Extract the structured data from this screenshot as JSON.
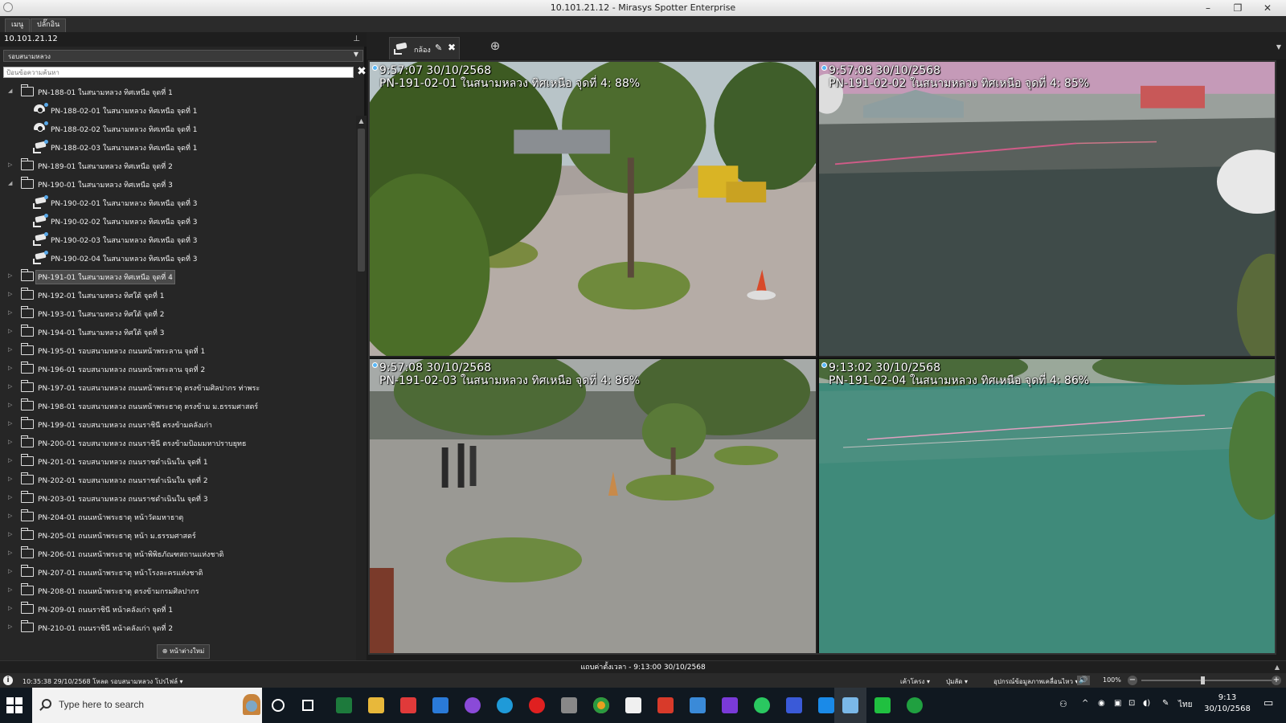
{
  "window": {
    "title": "10.101.21.12 - Mirasys Spotter Enterprise",
    "minimize": "–",
    "maximize": "❐",
    "close": "✕"
  },
  "menu_tabs": [
    "เมนู",
    "ปลั๊กอิน"
  ],
  "server": {
    "address": "10.101.21.12",
    "pin": "⊥"
  },
  "group_select": {
    "value": "รอบสนามหลวง",
    "caret": "▼"
  },
  "search": {
    "placeholder": "ป้อนข้อความค้นหา",
    "clear": "✖"
  },
  "tree": [
    {
      "type": "folder",
      "expander": "◢",
      "label": "PN-188-01 ในสนามหลวง ทิศเหนือ จุดที่ 1"
    },
    {
      "type": "dome",
      "label": "PN-188-02-01 ในสนามหลวง ทิศเหนือ จุดที่ 1"
    },
    {
      "type": "dome",
      "label": "PN-188-02-02 ในสนามหลวง ทิศเหนือ จุดที่ 1"
    },
    {
      "type": "bullet",
      "label": "PN-188-02-03 ในสนามหลวง ทิศเหนือ จุดที่ 1"
    },
    {
      "type": "folder",
      "expander": "▷",
      "label": "PN-189-01 ในสนามหลวง ทิศเหนือ จุดที่ 2"
    },
    {
      "type": "folder",
      "expander": "◢",
      "label": "PN-190-01 ในสนามหลวง ทิศเหนือ จุดที่ 3"
    },
    {
      "type": "bullet",
      "label": "PN-190-02-01 ในสนามหลวง ทิศเหนือ จุดที่ 3"
    },
    {
      "type": "bullet",
      "label": "PN-190-02-02 ในสนามหลวง ทิศเหนือ จุดที่ 3"
    },
    {
      "type": "bullet",
      "label": "PN-190-02-03 ในสนามหลวง ทิศเหนือ จุดที่ 3"
    },
    {
      "type": "bullet",
      "label": "PN-190-02-04 ในสนามหลวง ทิศเหนือ จุดที่ 3"
    },
    {
      "type": "folder",
      "expander": "▷",
      "label": "PN-191-01 ในสนามหลวง ทิศเหนือ จุดที่ 4",
      "selected": true
    },
    {
      "type": "folder",
      "expander": "▷",
      "label": "PN-192-01 ในสนามหลวง ทิศใต้ จุดที่ 1"
    },
    {
      "type": "folder",
      "expander": "▷",
      "label": "PN-193-01 ในสนามหลวง ทิศใต้ จุดที่ 2"
    },
    {
      "type": "folder",
      "expander": "▷",
      "label": "PN-194-01 ในสนามหลวง ทิศใต้ จุดที่ 3"
    },
    {
      "type": "folder",
      "expander": "▷",
      "label": "PN-195-01 รอบสนามหลวง ถนนหน้าพระลาน จุดที่ 1"
    },
    {
      "type": "folder",
      "expander": "▷",
      "label": "PN-196-01 รอบสนามหลวง ถนนหน้าพระลาน จุดที่ 2"
    },
    {
      "type": "folder",
      "expander": "▷",
      "label": "PN-197-01 รอบสนามหลวง ถนนหน้าพระธาตุ ตรงข้ามศิลปากร ท่าพระ"
    },
    {
      "type": "folder",
      "expander": "▷",
      "label": "PN-198-01 รอบสนามหลวง ถนนหน้าพระธาตุ ตรงข้าม ม.ธรรมศาสตร์"
    },
    {
      "type": "folder",
      "expander": "▷",
      "label": "PN-199-01 รอบสนามหลวง ถนนราชินี ตรงข้ามคลังเก่า"
    },
    {
      "type": "folder",
      "expander": "▷",
      "label": "PN-200-01 รอบสนามหลวง ถนนราชินี ตรงข้ามป้อมมหาปราบยุทธ"
    },
    {
      "type": "folder",
      "expander": "▷",
      "label": "PN-201-01 รอบสนามหลวง ถนนราชดำเนินใน จุดที่ 1"
    },
    {
      "type": "folder",
      "expander": "▷",
      "label": "PN-202-01 รอบสนามหลวง ถนนราชดำเนินใน จุดที่ 2"
    },
    {
      "type": "folder",
      "expander": "▷",
      "label": "PN-203-01 รอบสนามหลวง ถนนราชดำเนินใน จุดที่ 3"
    },
    {
      "type": "folder",
      "expander": "▷",
      "label": "PN-204-01 ถนนหน้าพระธาตุ หน้าวัดมหาธาตุ"
    },
    {
      "type": "folder",
      "expander": "▷",
      "label": "PN-205-01 ถนนหน้าพระธาตุ หน้า ม.ธรรมศาสตร์"
    },
    {
      "type": "folder",
      "expander": "▷",
      "label": "PN-206-01 ถนนหน้าพระธาตุ หน้าพิพิธภัณฑสถานแห่งชาติ"
    },
    {
      "type": "folder",
      "expander": "▷",
      "label": "PN-207-01 ถนนหน้าพระธาตุ หน้าโรงละครแห่งชาติ"
    },
    {
      "type": "folder",
      "expander": "▷",
      "label": "PN-208-01 ถนนหน้าพระธาตุ ตรงข้ามกรมศิลปากร"
    },
    {
      "type": "folder",
      "expander": "▷",
      "label": "PN-209-01 ถนนราชินี หน้าคลังเก่า จุดที่ 1"
    },
    {
      "type": "folder",
      "expander": "▷",
      "label": "PN-210-01 ถนนราชินี หน้าคลังเก่า จุดที่ 2"
    }
  ],
  "new_page_button": "⊕ หน้าต่างใหม่",
  "view": {
    "tab_label": "กล้อง",
    "tab_edit": "✎",
    "tab_close": "✖",
    "add_tab": "⊕",
    "menu_caret": "▼"
  },
  "tiles": [
    {
      "time": "9:57:07  30/10/2568",
      "name": "PN-191-02-01 ในสนามหลวง ทิศเหนือ จุดที่ 4: 88%"
    },
    {
      "time": "9:57:08  30/10/2568",
      "name": "PN-191-02-02 ในสนามหลวง ทิศเหนือ จุดที่ 4: 85%"
    },
    {
      "time": "9:57:08  30/10/2568",
      "name": "PN-191-02-03 ในสนามหลวง ทิศเหนือ จุดที่ 4: 86%"
    },
    {
      "time": "9:13:02  30/10/2568",
      "name": "PN-191-02-04 ในสนามหลวง ทิศเหนือ จุดที่ 4: 86%"
    }
  ],
  "timeline": {
    "label": "แถบค่าตั้งเวลา - 9:13:00  30/10/2568",
    "collapse": "▲"
  },
  "status": {
    "info": "i",
    "message": "10:35:38  29/10/2568  โหลด รอบสนามหลวง โปรไฟล์ ▾",
    "items": [
      "เค้าโครง ▾",
      "ปุ่มลัด ▾",
      "อุปกรณ์ข้อมูลภาพเคลื่อนไหว ▾"
    ],
    "speaker": "🔊",
    "zoom": "100%",
    "zoom_level": 0.46
  },
  "taskbar": {
    "search_placeholder": "Type here to search",
    "tray_lang": "ไทย",
    "time": "9:13",
    "date": "30/10/2568"
  }
}
